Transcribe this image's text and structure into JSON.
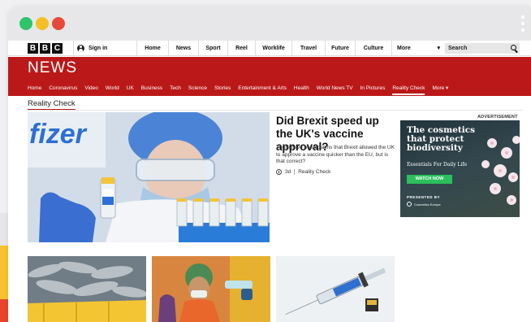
{
  "masthead": {
    "logo_letters": [
      "B",
      "B",
      "C"
    ],
    "signin_label": "Sign in",
    "nav": [
      "Home",
      "News",
      "Sport",
      "Reel",
      "Worklife",
      "Travel",
      "Future",
      "Culture",
      "More"
    ],
    "search_label": "Search"
  },
  "banner": {
    "title": "NEWS",
    "subnav": [
      "Home",
      "Coronavirus",
      "Video",
      "World",
      "UK",
      "Business",
      "Tech",
      "Science",
      "Stories",
      "Entertainment & Arts",
      "Health",
      "World News TV",
      "In Pictures",
      "Reality Check",
      "More ▾"
    ],
    "active": "Reality Check"
  },
  "section": {
    "title": "Reality Check"
  },
  "hero": {
    "headline": "Did Brexit speed up the UK's vaccine approval?",
    "summary": "There have been claims that Brexit allowed the UK to approve a vaccine quicker than the EU, but is that correct?",
    "time": "3d",
    "tag": "Reality Check",
    "image_text": "fizer"
  },
  "ad": {
    "label": "ADVERTISEMENT",
    "headline": "The cosmetics that protect biodiversity",
    "subline": "Essentials For Daily Life",
    "button": "WATCH NOW",
    "presented_by": "PRESENTED BY",
    "sponsor": "Cosmetics Europe"
  },
  "thumbnails": [
    {
      "name": "fish-market"
    },
    {
      "name": "illustration-worker"
    },
    {
      "name": "syringe-vaccine"
    }
  ],
  "colors": {
    "brand_red": "#bb1919",
    "ad_button": "#2bbf5d",
    "chrome_grey": "#e7e7e9"
  }
}
